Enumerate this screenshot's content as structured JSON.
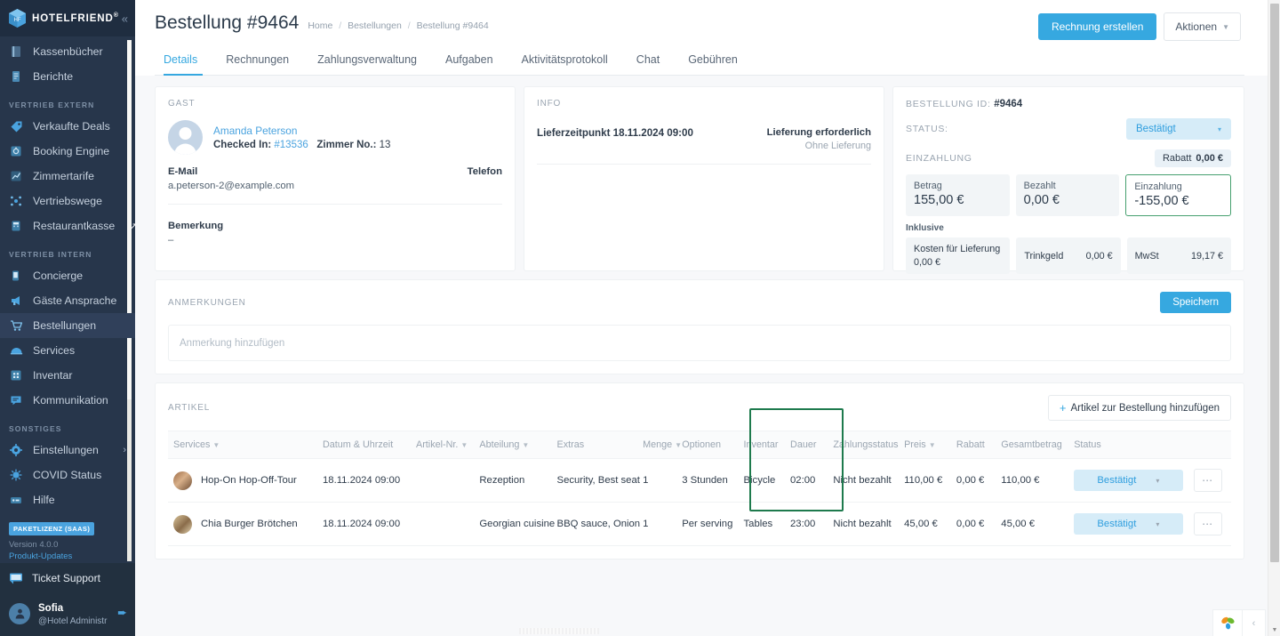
{
  "sidebar": {
    "brand": "HOTELFRIEND",
    "brand_reg": "®",
    "collapse_icon": "chevron-left-icon",
    "items": [
      {
        "label": "Kassenbücher",
        "icon": "book-icon",
        "active": false
      },
      {
        "label": "Berichte",
        "icon": "report-icon",
        "active": false
      }
    ],
    "section_extern": "VERTRIEB EXTERN",
    "items_extern": [
      {
        "label": "Verkaufte Deals",
        "icon": "tag-icon",
        "active": false
      },
      {
        "label": "Booking Engine",
        "icon": "engine-icon",
        "active": false
      },
      {
        "label": "Zimmertarife",
        "icon": "chart-icon",
        "active": false
      },
      {
        "label": "Vertriebswege",
        "icon": "network-icon",
        "active": false
      },
      {
        "label": "Restaurantkasse",
        "icon": "register-icon",
        "active": false,
        "external": true
      }
    ],
    "section_intern": "VERTRIEB INTERN",
    "items_intern": [
      {
        "label": "Concierge",
        "icon": "mobile-icon",
        "active": false
      },
      {
        "label": "Gäste Ansprache",
        "icon": "megaphone-icon",
        "active": false
      },
      {
        "label": "Bestellungen",
        "icon": "cart-icon",
        "active": true
      },
      {
        "label": "Services",
        "icon": "tray-icon",
        "active": false
      },
      {
        "label": "Inventar",
        "icon": "grid-icon",
        "active": false
      },
      {
        "label": "Kommunikation",
        "icon": "chat-icon",
        "active": false
      }
    ],
    "section_sonstiges": "SONSTIGES",
    "items_sonstiges": [
      {
        "label": "Einstellungen",
        "icon": "gear-icon",
        "active": false,
        "chevron": true
      },
      {
        "label": "COVID Status",
        "icon": "virus-icon",
        "active": false
      },
      {
        "label": "Hilfe",
        "icon": "help-icon",
        "active": false
      }
    ],
    "license_badge": "PAKETLIZENZ (SAAS)",
    "version": "Version 4.0.0",
    "updates_link": "Produkt-Updates",
    "ticket_support": "Ticket Support",
    "user_name": "Sofia",
    "user_role": "@Hotel Administr",
    "logout_icon": "logout-icon"
  },
  "header": {
    "title": "Bestellung #9464",
    "breadcrumb": [
      "Home",
      "Bestellungen",
      "Bestellung #9464"
    ],
    "breadcrumb_sep": "/",
    "primary_button": "Rechnung erstellen",
    "actions_button": "Aktionen"
  },
  "tabs": [
    {
      "label": "Details",
      "active": true
    },
    {
      "label": "Rechnungen",
      "active": false
    },
    {
      "label": "Zahlungsverwaltung",
      "active": false
    },
    {
      "label": "Aufgaben",
      "active": false
    },
    {
      "label": "Aktivitätsprotokoll",
      "active": false
    },
    {
      "label": "Chat",
      "active": false
    },
    {
      "label": "Gebühren",
      "active": false
    }
  ],
  "guest_card": {
    "label": "GAST",
    "name": "Amanda Peterson",
    "checked_in_label": "Checked In:",
    "checked_in_value": "#13536",
    "room_label": "Zimmer No.:",
    "room_value": "13",
    "email_label": "E-Mail",
    "email_value": "a.peterson-2@example.com",
    "phone_label": "Telefon",
    "phone_value": "",
    "remark_label": "Bemerkung",
    "remark_value": "–"
  },
  "info_card": {
    "label": "INFO",
    "delivery_time": "Lieferzeitpunkt 18.11.2024 09:00",
    "delivery_required": "Lieferung erforderlich",
    "delivery_note": "Ohne Lieferung"
  },
  "bill_card": {
    "order_id_label": "BESTELLUNG ID:",
    "order_id_value": "#9464",
    "status_label": "STATUS:",
    "status_value": "Bestätigt",
    "deposit_label": "EINZAHLUNG",
    "discount_label": "Rabatt",
    "discount_value": "0,00 €",
    "amounts": [
      {
        "label": "Betrag",
        "value": "155,00 €",
        "highlight": false
      },
      {
        "label": "Bezahlt",
        "value": "0,00 €",
        "highlight": false
      },
      {
        "label": "Einzahlung",
        "value": "-155,00 €",
        "highlight": true
      }
    ],
    "inclusive_label": "Inklusive",
    "inclusive": [
      {
        "label": "Kosten für Lieferung",
        "value": "0,00 €",
        "stacked": true
      },
      {
        "label": "Trinkgeld",
        "value": "0,00 €",
        "stacked": false
      },
      {
        "label": "MwSt",
        "value": "19,17 €",
        "stacked": false
      }
    ]
  },
  "notes_card": {
    "label": "ANMERKUNGEN",
    "save_button": "Speichern",
    "input_placeholder": "Anmerkung hinzufügen",
    "input_value": ""
  },
  "items_card": {
    "label": "ARTIKEL",
    "add_button": "Artikel zur Bestellung hinzufügen",
    "add_icon": "plus-icon",
    "columns": [
      {
        "label": "Services",
        "sortable": true
      },
      {
        "label": "Datum & Uhrzeit",
        "sortable": false
      },
      {
        "label": "Artikel-Nr.",
        "sortable": true
      },
      {
        "label": "Abteilung",
        "sortable": true
      },
      {
        "label": "Extras",
        "sortable": false
      },
      {
        "label": "Menge",
        "sortable": true
      },
      {
        "label": "Optionen",
        "sortable": false
      },
      {
        "label": "Inventar",
        "sortable": false
      },
      {
        "label": "Dauer",
        "sortable": false
      },
      {
        "label": "Zahlungsstatus",
        "sortable": false
      },
      {
        "label": "Preis",
        "sortable": true
      },
      {
        "label": "Rabatt",
        "sortable": false
      },
      {
        "label": "Gesamtbetrag",
        "sortable": false
      },
      {
        "label": "Status",
        "sortable": false
      },
      {
        "label": "",
        "sortable": false
      }
    ],
    "rows": [
      {
        "service": "Hop-On Hop-Off-Tour",
        "datetime": "18.11.2024 09:00",
        "article_no": "",
        "department": "Rezeption",
        "extras": "Security, Best seat",
        "quantity": "1",
        "options": "3 Stunden",
        "inventory": "Bicycle",
        "duration": "02:00",
        "payment_status": "Nicht bezahlt",
        "price": "110,00 €",
        "discount": "0,00 €",
        "total": "110,00 €",
        "status": "Bestätigt",
        "menu_icon": "more-dots-icon"
      },
      {
        "service": "Chia Burger Brötchen",
        "datetime": "18.11.2024 09:00",
        "article_no": "",
        "department": "Georgian cuisine",
        "extras": "BBQ sauce, Onion",
        "quantity": "1",
        "options": "Per serving",
        "inventory": "Tables",
        "duration": "23:00",
        "payment_status": "Nicht bezahlt",
        "price": "45,00 €",
        "discount": "0,00 €",
        "total": "45,00 €",
        "status": "Bestätigt",
        "menu_icon": "more-dots-icon"
      }
    ],
    "highlight_color": "#1e7a4d"
  },
  "colors": {
    "accent": "#36a8e0",
    "sidebar_bg": "#27364b",
    "status_pill_bg": "#d6ecf8",
    "status_pill_text": "#2f9ede",
    "highlight_green": "#1e7a4d",
    "deposit_border": "#46a06f"
  },
  "widgets": {
    "helper_icon": "leaf-widget-icon",
    "collapse_icon": "chevron-left-icon"
  }
}
